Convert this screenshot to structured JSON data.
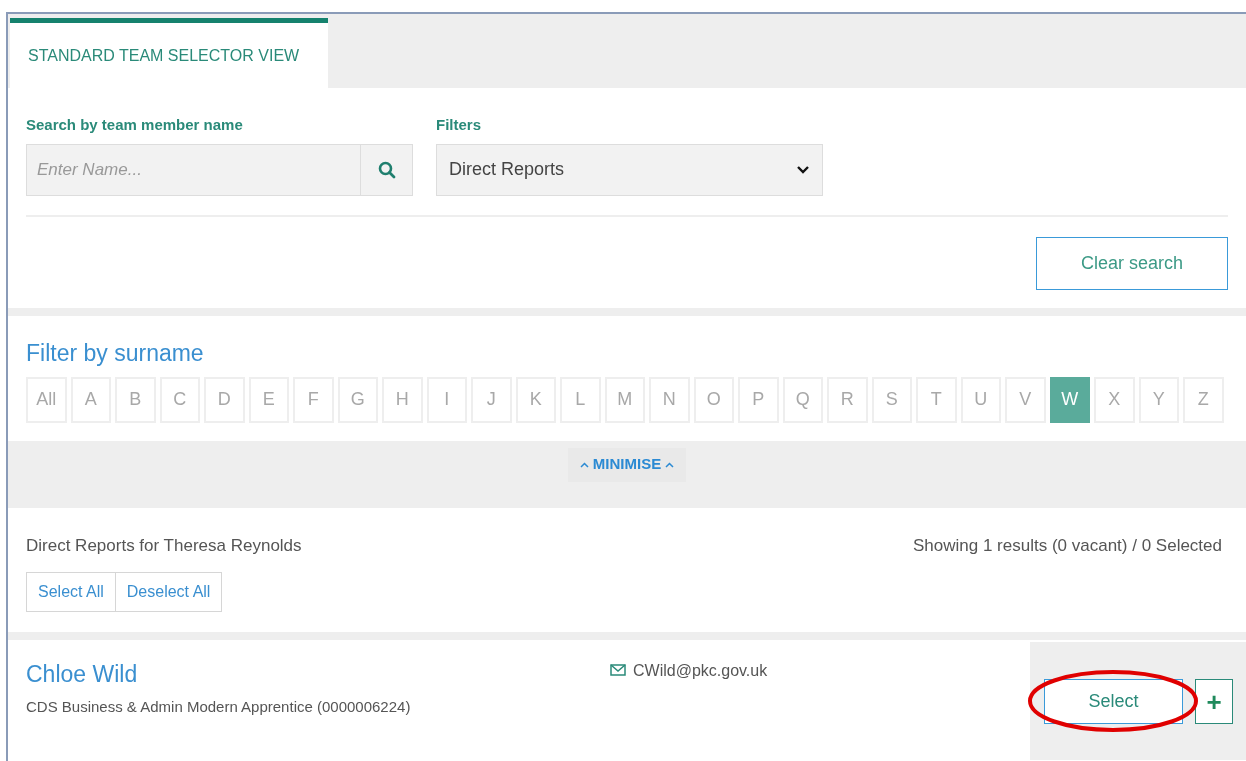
{
  "tabs": [
    {
      "label": "STANDARD TEAM SELECTOR VIEW",
      "selected": true
    }
  ],
  "search": {
    "label": "Search by team member name",
    "placeholder": "Enter Name..."
  },
  "filters": {
    "label": "Filters",
    "value": "Direct Reports"
  },
  "clear_button": "Clear search",
  "surname_filter": {
    "title": "Filter by surname",
    "letters": [
      {
        "label": "All",
        "selected": false
      },
      {
        "label": "A",
        "selected": false
      },
      {
        "label": "B",
        "selected": false
      },
      {
        "label": "C",
        "selected": false
      },
      {
        "label": "D",
        "selected": false
      },
      {
        "label": "E",
        "selected": false
      },
      {
        "label": "F",
        "selected": false
      },
      {
        "label": "G",
        "selected": false
      },
      {
        "label": "H",
        "selected": false
      },
      {
        "label": "I",
        "selected": false
      },
      {
        "label": "J",
        "selected": false
      },
      {
        "label": "K",
        "selected": false
      },
      {
        "label": "L",
        "selected": false
      },
      {
        "label": "M",
        "selected": false
      },
      {
        "label": "N",
        "selected": false
      },
      {
        "label": "O",
        "selected": false
      },
      {
        "label": "P",
        "selected": false
      },
      {
        "label": "Q",
        "selected": false
      },
      {
        "label": "R",
        "selected": false
      },
      {
        "label": "S",
        "selected": false
      },
      {
        "label": "T",
        "selected": false
      },
      {
        "label": "U",
        "selected": false
      },
      {
        "label": "V",
        "selected": false
      },
      {
        "label": "W",
        "selected": true
      },
      {
        "label": "X",
        "selected": false
      },
      {
        "label": "Y",
        "selected": false
      },
      {
        "label": "Z",
        "selected": false
      }
    ]
  },
  "minimise": "MINIMISE",
  "results": {
    "heading": "Direct Reports for Theresa Reynolds",
    "summary": "Showing 1 results (0 vacant) / 0 Selected",
    "buttons": [
      "Select All",
      "Deselect All"
    ]
  },
  "members": [
    {
      "name": "Chloe Wild",
      "role": "CDS Business & Admin Modern Apprentice (0000006224)",
      "email": "CWild@pkc.gov.uk",
      "select_label": "Select",
      "add_label": "+",
      "highlighted": true
    }
  ]
}
